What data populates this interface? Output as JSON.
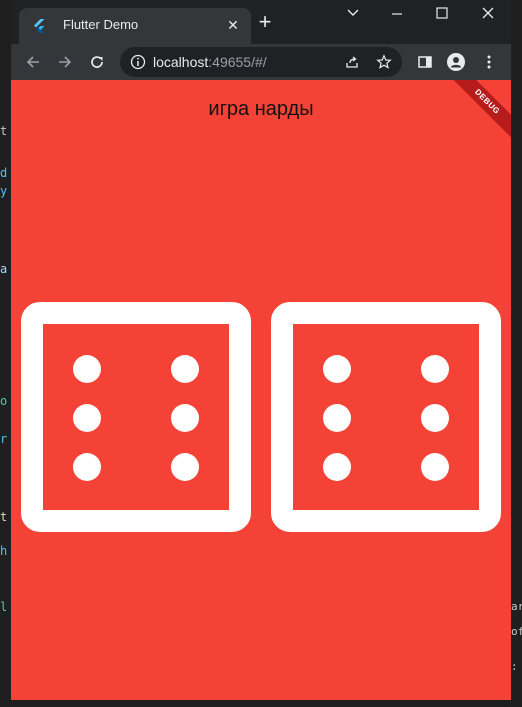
{
  "browser": {
    "tab_title": "Flutter Demo",
    "url_host": "localhost",
    "url_rest": ":49655/#/",
    "new_tab_symbol": "+",
    "tab_close_symbol": "✕",
    "icons": [
      "flutter-favicon",
      "back-arrow-icon",
      "forward-arrow-icon",
      "reload-icon",
      "info-icon",
      "share-icon",
      "star-icon",
      "sidebar-icon",
      "profile-icon",
      "kebab-menu-icon",
      "chevron-down-icon",
      "minimize-icon",
      "maximize-icon",
      "close-icon"
    ]
  },
  "app": {
    "title": "игра нарды",
    "debug_label": "DEBUG",
    "background_color": "#f44336",
    "dice": [
      {
        "face": 6
      },
      {
        "face": 6
      }
    ]
  },
  "background_snippets": [
    "t",
    "d",
    "y",
    "a",
    "o",
    "r",
    "t",
    "h",
    "l",
    "art",
    "of",
    ": D"
  ]
}
